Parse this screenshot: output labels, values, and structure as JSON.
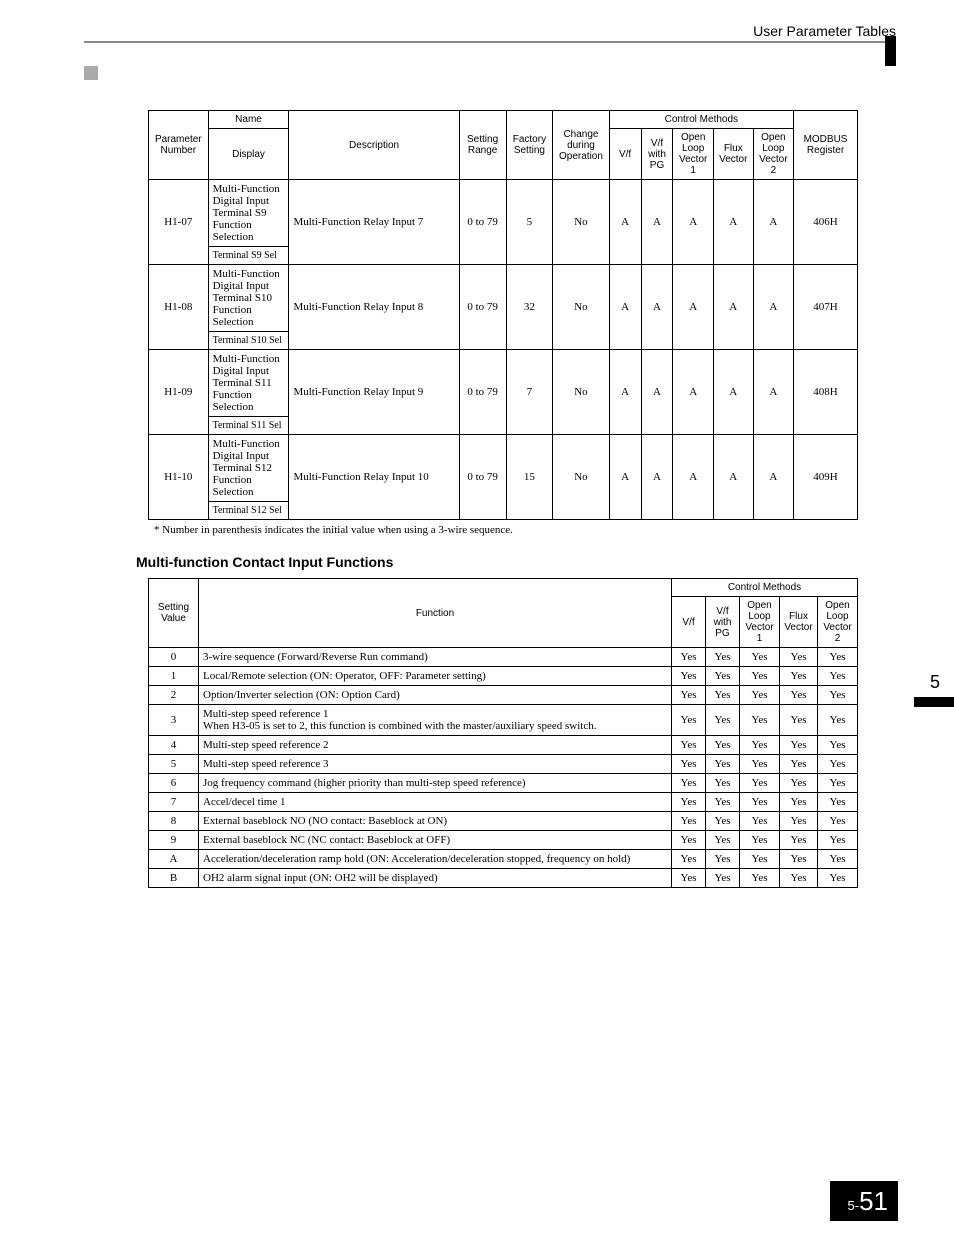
{
  "header": {
    "section": "User Parameter Tables"
  },
  "side_marker": "5",
  "page_number": {
    "prefix": "5-",
    "num": "51"
  },
  "table1": {
    "headers": {
      "param": "Parameter Number",
      "name": "Name",
      "display": "Display",
      "desc": "Description",
      "range": "Setting Range",
      "factory": "Factory Setting",
      "change": "Change during Operation",
      "ctrl": "Control Methods",
      "vf": "V/f",
      "vfpg": "V/f with PG",
      "olv1": "Open Loop Vector 1",
      "flux": "Flux Vector",
      "olv2": "Open Loop Vector 2",
      "modbus": "MODBUS Register"
    },
    "rows": [
      {
        "param": "H1-07",
        "name": "Multi-Function Digital Input Terminal S9 Function Selection",
        "display": "Terminal S9 Sel",
        "desc": "Multi-Function Relay Input 7",
        "range": "0 to 79",
        "factory": "5",
        "change": "No",
        "vf": "A",
        "vfpg": "A",
        "olv1": "A",
        "flux": "A",
        "olv2": "A",
        "modbus": "406H"
      },
      {
        "param": "H1-08",
        "name": "Multi-Function Digital Input Terminal S10 Function Selection",
        "display": "Terminal S10 Sel",
        "desc": "Multi-Function Relay Input 8",
        "range": "0 to 79",
        "factory": "32",
        "change": "No",
        "vf": "A",
        "vfpg": "A",
        "olv1": "A",
        "flux": "A",
        "olv2": "A",
        "modbus": "407H"
      },
      {
        "param": "H1-09",
        "name": "Multi-Function Digital Input Terminal S11 Function Selection",
        "display": "Terminal S11 Sel",
        "desc": "Multi-Function Relay Input 9",
        "range": "0 to 79",
        "factory": "7",
        "change": "No",
        "vf": "A",
        "vfpg": "A",
        "olv1": "A",
        "flux": "A",
        "olv2": "A",
        "modbus": "408H"
      },
      {
        "param": "H1-10",
        "name": "Multi-Function Digital Input Terminal S12 Function Selection",
        "display": "Terminal S12 Sel",
        "desc": "Multi-Function Relay Input 10",
        "range": "0 to 79",
        "factory": "15",
        "change": "No",
        "vf": "A",
        "vfpg": "A",
        "olv1": "A",
        "flux": "A",
        "olv2": "A",
        "modbus": "409H"
      }
    ],
    "footnote": "*  Number in parenthesis indicates the initial value when using a 3-wire sequence."
  },
  "section2": {
    "title": "Multi-function Contact Input Functions"
  },
  "table2": {
    "headers": {
      "val": "Setting Value",
      "func": "Function",
      "ctrl": "Control Methods",
      "vf": "V/f",
      "vfpg": "V/f with PG",
      "olv1": "Open Loop Vector 1",
      "flux": "Flux Vector",
      "olv2": "Open Loop Vector 2"
    },
    "rows": [
      {
        "val": "0",
        "func": "3-wire sequence (Forward/Reverse Run command)",
        "vf": "Yes",
        "vfpg": "Yes",
        "olv1": "Yes",
        "flux": "Yes",
        "olv2": "Yes"
      },
      {
        "val": "1",
        "func": "Local/Remote selection (ON: Operator, OFF: Parameter setting)",
        "vf": "Yes",
        "vfpg": "Yes",
        "olv1": "Yes",
        "flux": "Yes",
        "olv2": "Yes"
      },
      {
        "val": "2",
        "func": "Option/Inverter selection (ON: Option Card)",
        "vf": "Yes",
        "vfpg": "Yes",
        "olv1": "Yes",
        "flux": "Yes",
        "olv2": "Yes"
      },
      {
        "val": "3",
        "func": "Multi-step speed reference 1\nWhen H3-05 is set to 2, this function is combined with the master/auxiliary speed switch.",
        "vf": "Yes",
        "vfpg": "Yes",
        "olv1": "Yes",
        "flux": "Yes",
        "olv2": "Yes"
      },
      {
        "val": "4",
        "func": "Multi-step speed reference 2",
        "vf": "Yes",
        "vfpg": "Yes",
        "olv1": "Yes",
        "flux": "Yes",
        "olv2": "Yes"
      },
      {
        "val": "5",
        "func": "Multi-step speed reference 3",
        "vf": "Yes",
        "vfpg": "Yes",
        "olv1": "Yes",
        "flux": "Yes",
        "olv2": "Yes"
      },
      {
        "val": "6",
        "func": "Jog frequency command (higher priority than multi-step speed reference)",
        "vf": "Yes",
        "vfpg": "Yes",
        "olv1": "Yes",
        "flux": "Yes",
        "olv2": "Yes"
      },
      {
        "val": "7",
        "func": "Accel/decel time 1",
        "vf": "Yes",
        "vfpg": "Yes",
        "olv1": "Yes",
        "flux": "Yes",
        "olv2": "Yes"
      },
      {
        "val": "8",
        "func": "External baseblock NO (NO contact: Baseblock at ON)",
        "vf": "Yes",
        "vfpg": "Yes",
        "olv1": "Yes",
        "flux": "Yes",
        "olv2": "Yes"
      },
      {
        "val": "9",
        "func": "External baseblock NC (NC contact: Baseblock at OFF)",
        "vf": "Yes",
        "vfpg": "Yes",
        "olv1": "Yes",
        "flux": "Yes",
        "olv2": "Yes"
      },
      {
        "val": "A",
        "func": "Acceleration/deceleration ramp hold (ON: Acceleration/deceleration stopped, frequency on hold)",
        "vf": "Yes",
        "vfpg": "Yes",
        "olv1": "Yes",
        "flux": "Yes",
        "olv2": "Yes"
      },
      {
        "val": "B",
        "func": "OH2 alarm signal input (ON: OH2 will be displayed)",
        "vf": "Yes",
        "vfpg": "Yes",
        "olv1": "Yes",
        "flux": "Yes",
        "olv2": "Yes"
      }
    ]
  }
}
